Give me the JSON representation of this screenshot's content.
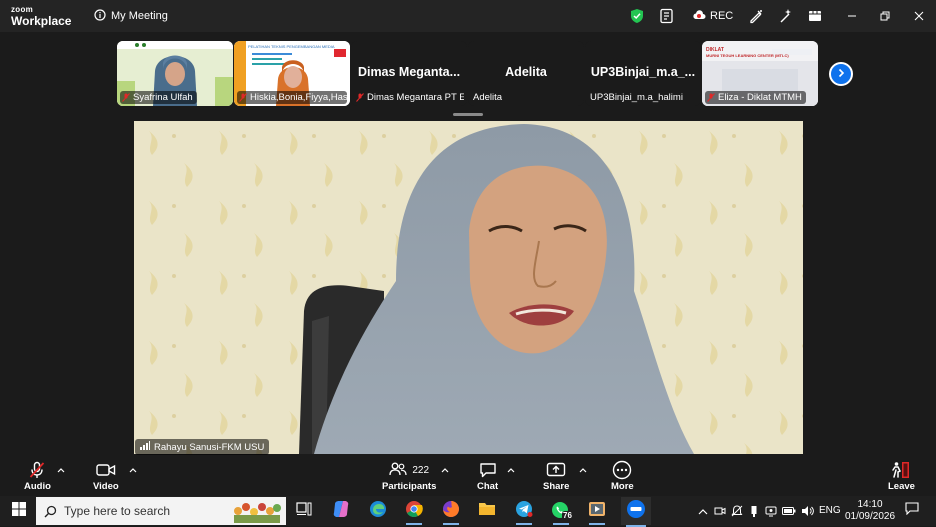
{
  "app": {
    "logo_line1": "zoom",
    "logo_line2": "Workplace",
    "meeting_title": "My Meeting",
    "rec_label": "REC"
  },
  "thumbnails": [
    {
      "name": "Syafrina Ulfah",
      "type": "video",
      "muted": true
    },
    {
      "name": "Hiskia,Bonia,Fiyya,Has...",
      "type": "video",
      "muted": true
    },
    {
      "name": "Dimas Megantara PT E...",
      "big_name": "Dimas  Meganta...",
      "type": "name",
      "muted": true
    },
    {
      "name": "Adelita",
      "big_name": "Adelita",
      "type": "name",
      "muted": false
    },
    {
      "name": "UP3Binjai_m.a_halimi",
      "big_name": "UP3Binjai_m.a_...",
      "type": "name",
      "muted": false
    },
    {
      "name": "Eliza - Diklat MTMH",
      "type": "video",
      "muted": true
    }
  ],
  "slide_texts": {
    "hiskia_slide": "PELATIHAN TEKNIS PENGEMBANGAN MEDIA",
    "eliza_slide_line1": "DIKLAT",
    "eliza_slide_line2": "MURNI TEGUH LEARNING CENTER (MTLC)"
  },
  "main_video": {
    "speaker_name": "Rahayu Sanusi-FKM USU"
  },
  "toolbar": {
    "audio_label": "Audio",
    "video_label": "Video",
    "participants_label": "Participants",
    "participants_count": "222",
    "chat_label": "Chat",
    "share_label": "Share",
    "more_label": "More",
    "leave_label": "Leave"
  },
  "taskbar": {
    "search_placeholder": "Type here to search",
    "whatsapp_badge": "76",
    "language": "ENG",
    "time": "14:10",
    "date": "01/09/2026"
  },
  "colors": {
    "accent_blue": "#0e72ed",
    "muted_red": "#e02828",
    "shield_green": "#23c552",
    "background": "#1b1b1b"
  }
}
